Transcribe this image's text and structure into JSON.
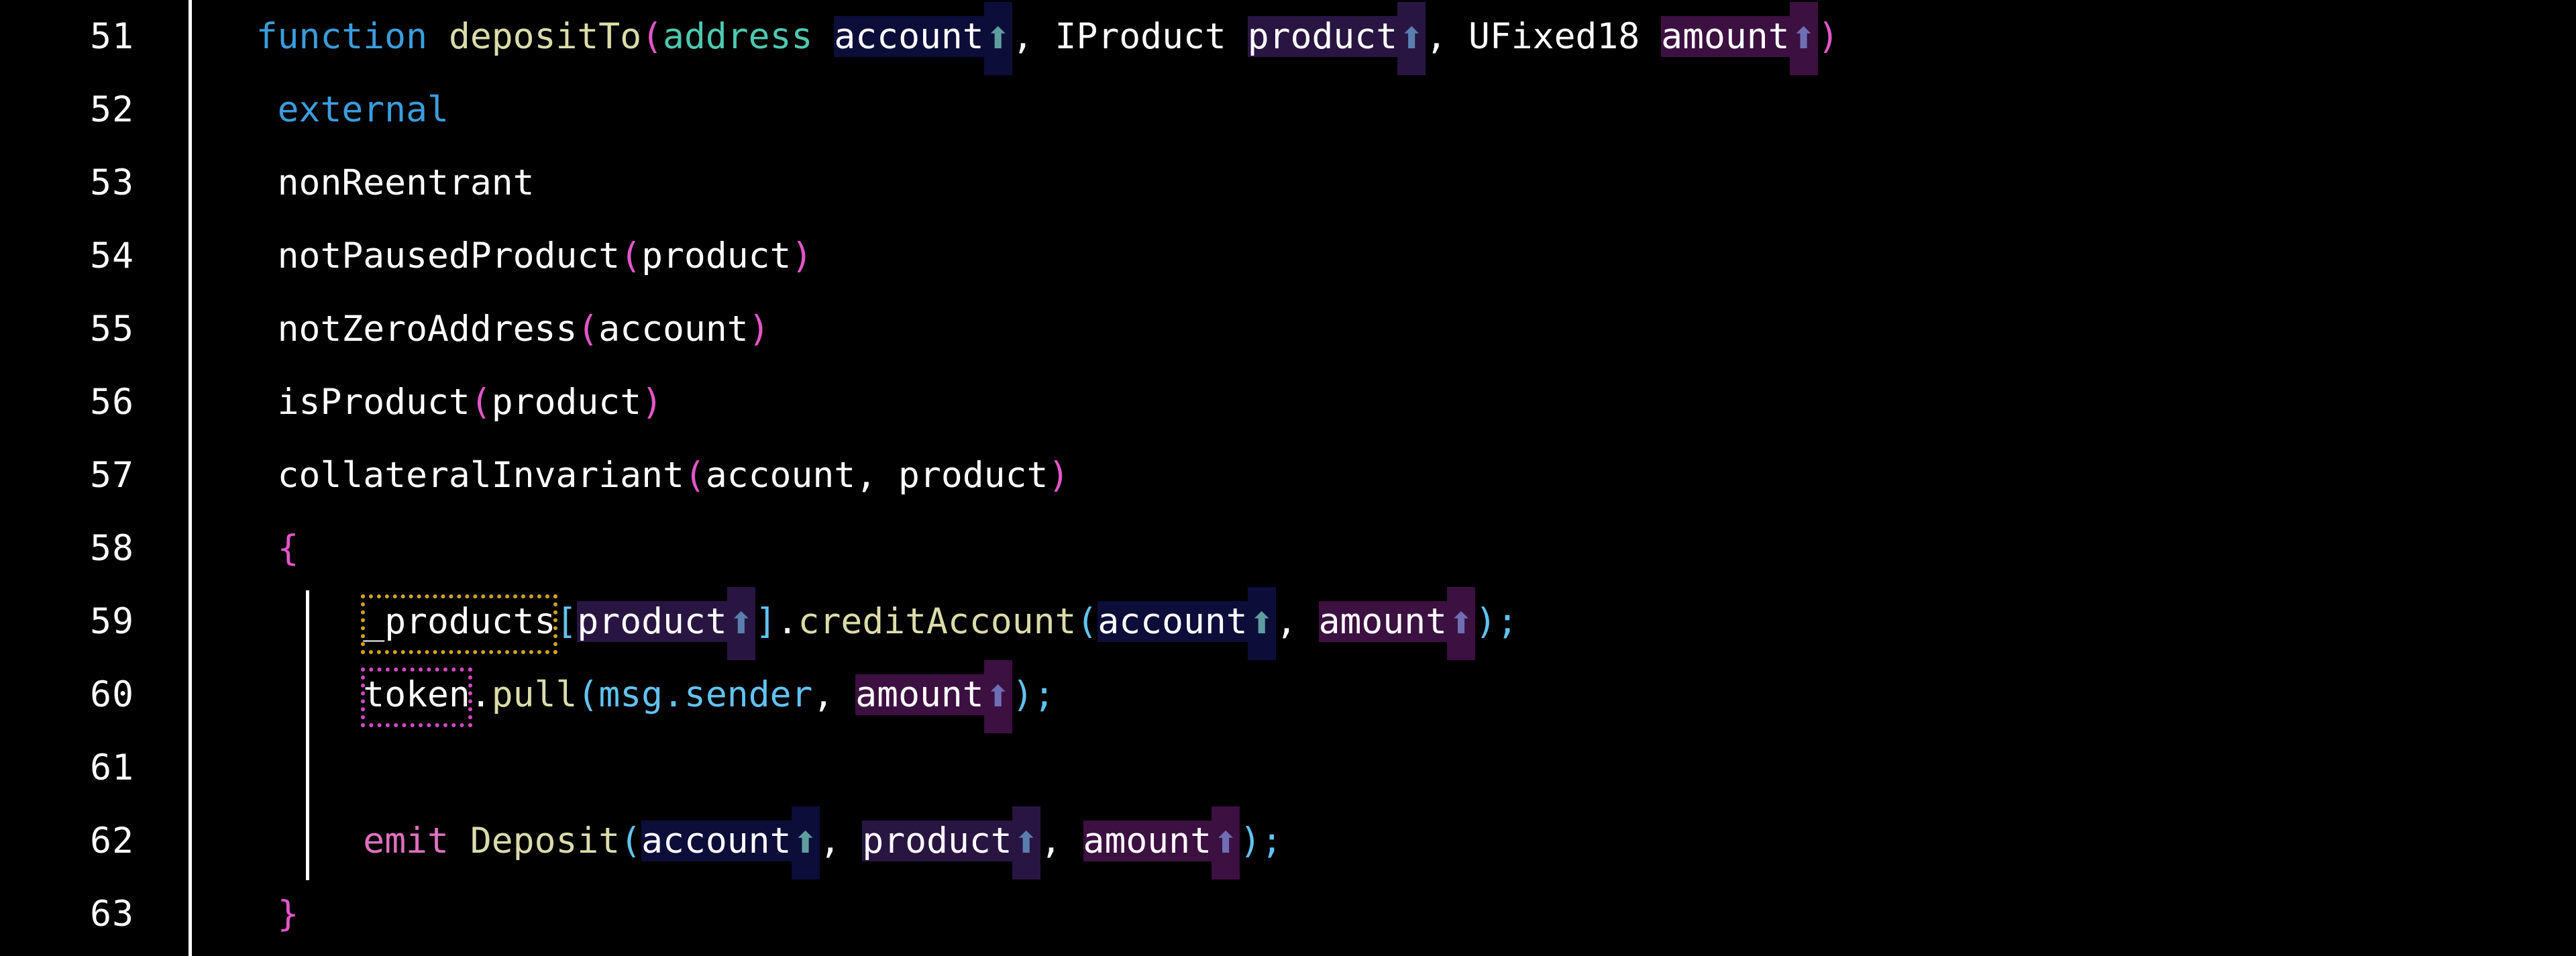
{
  "editor": {
    "language": "solidity",
    "theme": {
      "background": "#000000",
      "foreground": "#ffffff",
      "gutter_rule": "#ffffff",
      "keyword": "#3b9ddd",
      "function": "#dcdcaa",
      "type": "#4ec9b0",
      "paren": "#e356c9",
      "bracket": "#61c3f2",
      "emit_keyword": "#e070c0",
      "chip_account_bg": "#0d0d3a",
      "chip_product_bg": "#291542",
      "chip_amount_bg": "#3c1040",
      "arrow_account": "#5f9ea0",
      "arrow_product": "#5a7fae",
      "arrow_amount": "#6f6fb5",
      "box_orange": "#d6a314",
      "box_magenta": "#d946c8",
      "indent_guide": "#ffffff"
    },
    "gutter": {
      "line_numbers": [
        "51",
        "52",
        "53",
        "54",
        "55",
        "56",
        "57",
        "58",
        "59",
        "60",
        "61",
        "62",
        "63"
      ]
    },
    "lines": {
      "l51": {
        "number": "51",
        "text": "function depositTo(address account⬆, IProduct product⬆, UFixed18 amount⬆)",
        "tokens": {
          "kw_function": "function",
          "fn_name": "depositTo",
          "lparen": "(",
          "type_address": "address",
          "param_account": "account",
          "comma1": ", ",
          "type_iproduct": "IProduct",
          "param_product": "product",
          "comma2": ", ",
          "type_ufixed18": "UFixed18",
          "param_amount": "amount",
          "rparen": ")"
        }
      },
      "l52": {
        "number": "52",
        "text": "external"
      },
      "l53": {
        "number": "53",
        "text": "nonReentrant"
      },
      "l54": {
        "number": "54",
        "text": "notPausedProduct(product)",
        "tokens": {
          "name": "notPausedProduct",
          "lparen": "(",
          "arg": "product",
          "rparen": ")"
        }
      },
      "l55": {
        "number": "55",
        "text": "notZeroAddress(account)",
        "tokens": {
          "name": "notZeroAddress",
          "lparen": "(",
          "arg": "account",
          "rparen": ")"
        }
      },
      "l56": {
        "number": "56",
        "text": "isProduct(product)",
        "tokens": {
          "name": "isProduct",
          "lparen": "(",
          "arg": "product",
          "rparen": ")"
        }
      },
      "l57": {
        "number": "57",
        "text": "collateralInvariant(account, product)",
        "tokens": {
          "name": "collateralInvariant",
          "lparen": "(",
          "arg1": "account",
          "comma": ", ",
          "arg2": "product",
          "rparen": ")"
        }
      },
      "l58": {
        "number": "58",
        "text": "{",
        "tokens": {
          "brace": "{"
        }
      },
      "l59": {
        "number": "59",
        "text": "_products[product⬆].creditAccount(account⬆, amount⬆);",
        "tokens": {
          "var_products": "_products",
          "lbracket": "[",
          "idx_product": "product",
          "rbracket": "]",
          "dot": ".",
          "method": "creditAccount",
          "lparen": "(",
          "arg_account": "account",
          "comma": ", ",
          "arg_amount": "amount",
          "rparen": ")",
          "semi": ";"
        }
      },
      "l60": {
        "number": "60",
        "text": "token.pull(msg.sender, amount⬆);",
        "tokens": {
          "var_token": "token",
          "dot1": ".",
          "method": "pull",
          "lparen": "(",
          "msg": "msg",
          "dot2": ".",
          "sender": "sender",
          "comma": ", ",
          "arg_amount": "amount",
          "rparen": ")",
          "semi": ";"
        }
      },
      "l61": {
        "number": "61",
        "text": ""
      },
      "l62": {
        "number": "62",
        "text": "emit Deposit(account⬆, product⬆, amount⬆);",
        "tokens": {
          "kw_emit": "emit",
          "event_name": "Deposit",
          "lparen": "(",
          "arg_account": "account",
          "comma1": ", ",
          "arg_product": "product",
          "comma2": ", ",
          "arg_amount": "amount",
          "rparen": ")",
          "semi": ";"
        }
      },
      "l63": {
        "number": "63",
        "text": "}",
        "tokens": {
          "brace": "}"
        }
      }
    },
    "glyphs": {
      "up_arrow": "⬆",
      "space": " "
    }
  }
}
